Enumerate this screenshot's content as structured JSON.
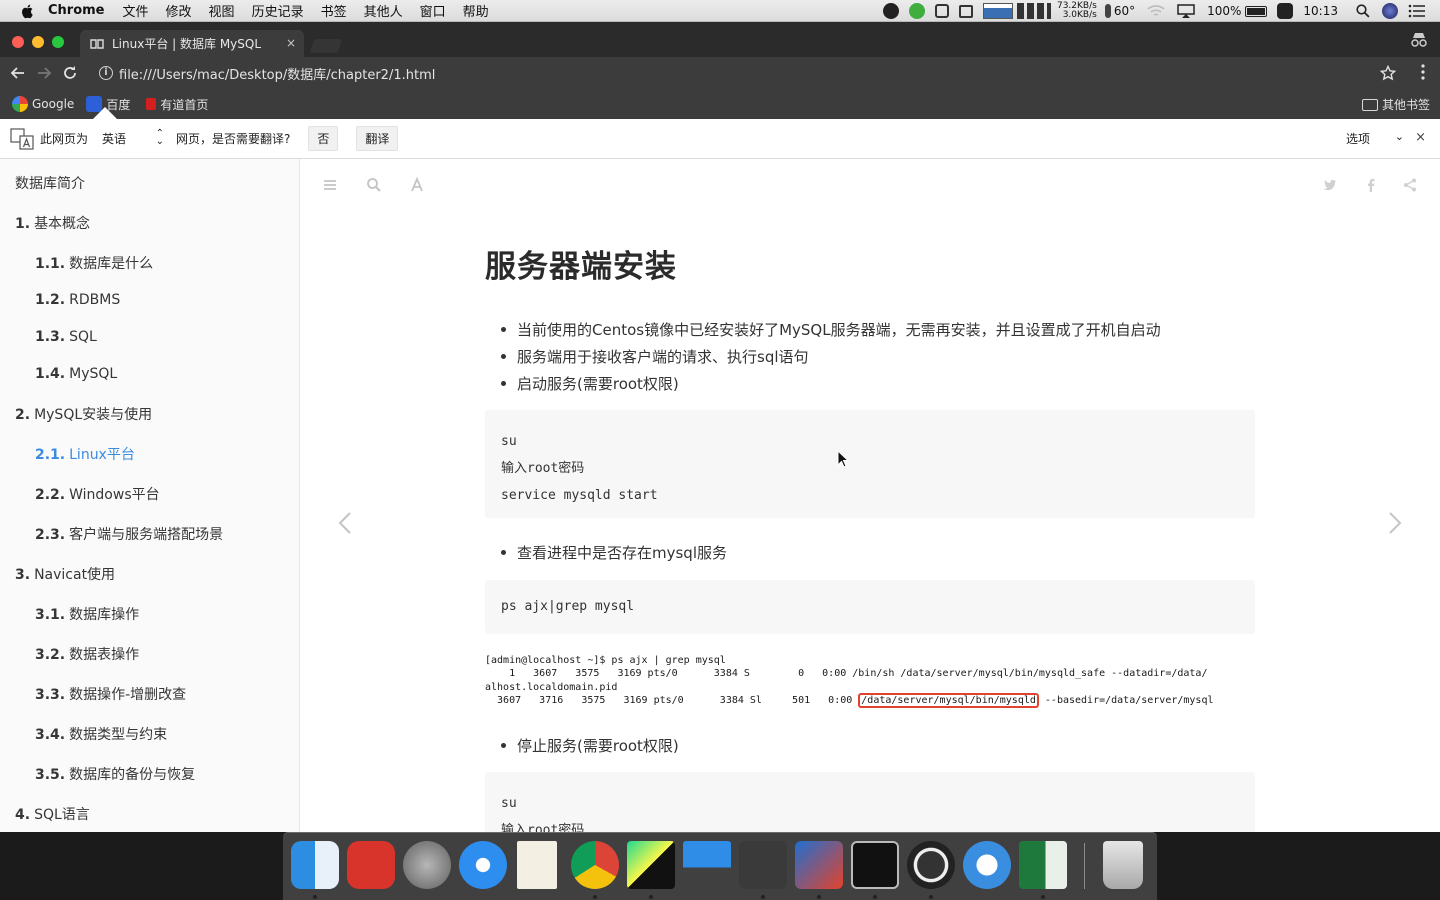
{
  "menubar": {
    "app": "Chrome",
    "items": [
      "文件",
      "修改",
      "视图",
      "历史记录",
      "书签",
      "其他人",
      "窗口",
      "帮助"
    ],
    "net_up": "73.2KB/s",
    "net_down": "3.0KB/s",
    "temp": "60°",
    "battery": "100%",
    "time": "10:13"
  },
  "tab": {
    "title": "Linux平台 | 数据库 MySQL",
    "close": "×"
  },
  "address": {
    "url": "file:///Users/mac/Desktop/数据库/chapter2/1.html",
    "info": "i"
  },
  "bookmarks": {
    "items": [
      "Google",
      "百度",
      "有道首页"
    ],
    "other": "其他书签"
  },
  "translate": {
    "prefix": "此网页为",
    "language": "英语",
    "question": "网页，是否需要翻译?",
    "no": "否",
    "translate": "翻译",
    "options": "选项",
    "close": "×"
  },
  "sidebar": {
    "items": [
      {
        "num": "",
        "label": "数据库简介"
      },
      {
        "num": "1.",
        "label": "基本概念"
      },
      {
        "num": "1.1.",
        "label": "数据库是什么"
      },
      {
        "num": "1.2.",
        "label": "RDBMS"
      },
      {
        "num": "1.3.",
        "label": "SQL"
      },
      {
        "num": "1.4.",
        "label": "MySQL"
      },
      {
        "num": "2.",
        "label": "MySQL安装与使用"
      },
      {
        "num": "2.1.",
        "label": "Linux平台"
      },
      {
        "num": "2.2.",
        "label": "Windows平台"
      },
      {
        "num": "2.3.",
        "label": "客户端与服务端搭配场景"
      },
      {
        "num": "3.",
        "label": "Navicat使用"
      },
      {
        "num": "3.1.",
        "label": "数据库操作"
      },
      {
        "num": "3.2.",
        "label": "数据表操作"
      },
      {
        "num": "3.3.",
        "label": "数据操作-增删改查"
      },
      {
        "num": "3.4.",
        "label": "数据类型与约束"
      },
      {
        "num": "3.5.",
        "label": "数据库的备份与恢复"
      },
      {
        "num": "4.",
        "label": "SQL语言"
      }
    ]
  },
  "content": {
    "title": "服务器端安装",
    "bullets1": [
      "当前使用的Centos镜像中已经安装好了MySQL服务器端，无需再安装，并且设置成了开机自启动",
      "服务端用于接收客户端的请求、执行sql语句",
      "启动服务(需要root权限)"
    ],
    "code1": [
      "su",
      "输入root密码",
      "service mysqld start"
    ],
    "bullet2": "查看进程中是否存在mysql服务",
    "code2": [
      "ps ajx|grep mysql"
    ],
    "terminal": {
      "line1": "[admin@localhost ~]$ ps ajx | grep mysql",
      "line2": "    1   3607   3575   3169 pts/0      3384 S        0   0:00 /bin/sh /data/server/mysql/bin/mysqld_safe --datadir=/data/",
      "line3": "alhost.localdomain.pid",
      "line4_pre": "  3607   3716   3575   3169 pts/0      3384 Sl     501   0:00 ",
      "line4_hl": "/data/server/mysql/bin/mysqld",
      "line4_post": " --basedir=/data/server/mysql"
    },
    "bullet3": "停止服务(需要root权限)",
    "code3": [
      "su",
      "输入root密码"
    ]
  },
  "colors": {
    "accent": "#3b8be0",
    "highlight": "#e0442f"
  }
}
